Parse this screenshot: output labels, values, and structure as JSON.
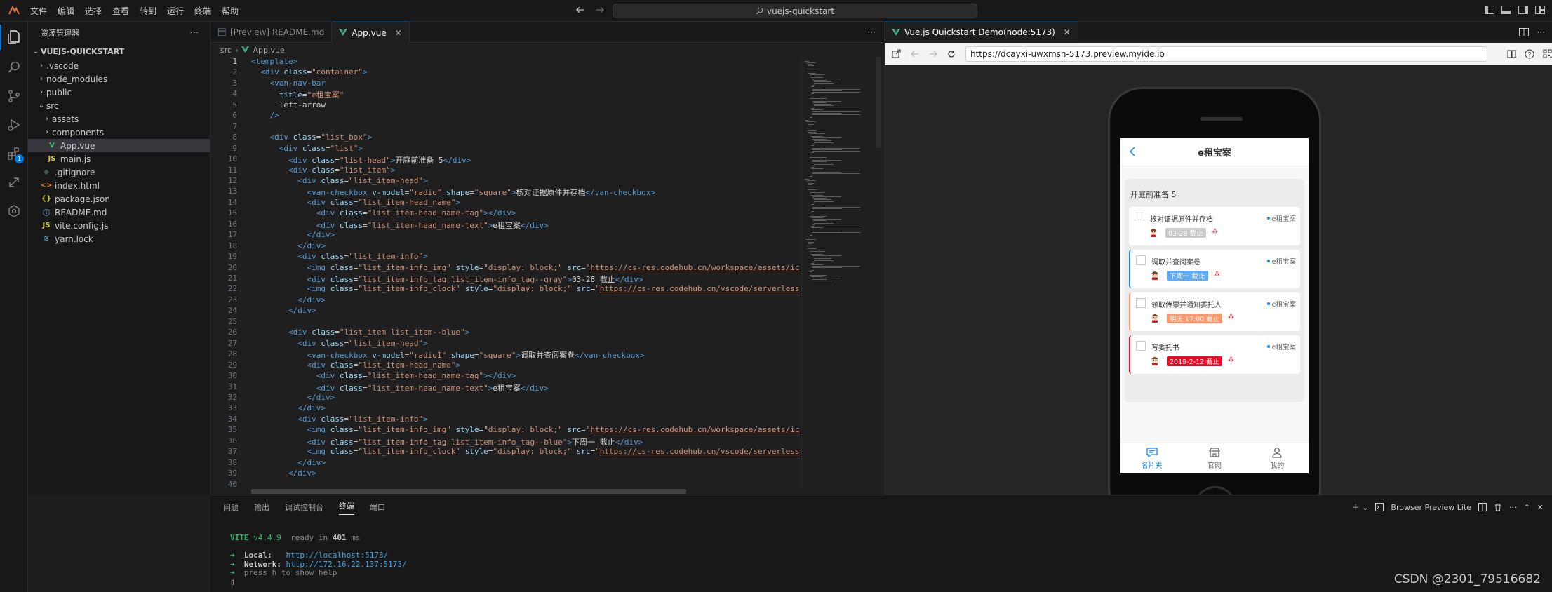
{
  "menubar": {
    "items": [
      "文件",
      "编辑",
      "选择",
      "查看",
      "转到",
      "运行",
      "终端",
      "帮助"
    ]
  },
  "command_center": {
    "text": "vuejs-quickstart"
  },
  "activity": {
    "extensions_badge": "1"
  },
  "explorer": {
    "title": "资源管理器",
    "root": "VUEJS-QUICKSTART",
    "items": [
      {
        "label": ".vscode",
        "kind": "folder",
        "depth": 1
      },
      {
        "label": "node_modules",
        "kind": "folder",
        "depth": 1
      },
      {
        "label": "public",
        "kind": "folder",
        "depth": 1
      },
      {
        "label": "src",
        "kind": "folder-open",
        "depth": 1
      },
      {
        "label": "assets",
        "kind": "folder",
        "depth": 2
      },
      {
        "label": "components",
        "kind": "folder",
        "depth": 2
      },
      {
        "label": "App.vue",
        "kind": "vue",
        "depth": 2,
        "selected": true
      },
      {
        "label": "main.js",
        "kind": "js",
        "depth": 2
      },
      {
        "label": ".gitignore",
        "kind": "git",
        "depth": 1
      },
      {
        "label": "index.html",
        "kind": "html",
        "depth": 1
      },
      {
        "label": "package.json",
        "kind": "json",
        "depth": 1
      },
      {
        "label": "README.md",
        "kind": "md",
        "depth": 1
      },
      {
        "label": "vite.config.js",
        "kind": "js",
        "depth": 1
      },
      {
        "label": "yarn.lock",
        "kind": "yarn",
        "depth": 1
      }
    ]
  },
  "editor": {
    "tabs": [
      {
        "label": "[Preview] README.md",
        "active": false
      },
      {
        "label": "App.vue",
        "active": true
      }
    ],
    "breadcrumb": [
      "src",
      "App.vue"
    ],
    "current_line": 1,
    "lines": [
      "<template>",
      "  <div class=\"container\">",
      "    <van-nav-bar",
      "      title=\"e租宝案\"",
      "      left-arrow",
      "    />",
      "",
      "    <div class=\"list_box\">",
      "      <div class=\"list\">",
      "        <div class=\"list-head\">开庭前准备 5</div>",
      "        <div class=\"list_item\">",
      "          <div class=\"list_item-head\">",
      "            <van-checkbox v-model=\"radio\" shape=\"square\">核对证据原件并存档</van-checkbox>",
      "            <div class=\"list_item-head_name\">",
      "              <div class=\"list_item-head_name-tag\"></div>",
      "              <div class=\"list_item-head_name-text\">e租宝案</div>",
      "            </div>",
      "          </div>",
      "          <div class=\"list_item-info\">",
      "            <img class=\"list_item-info_img\" style=\"display: block;\" src=\"https://cs-res.codehub.cn/workspace/assets/icons/embe",
      "            <div class=\"list_item-info_tag list_item-info_tag--gray\">03-28 截止</div>",
      "            <img class=\"list_item-info_clock\" style=\"display: block;\" src=\"https://cs-res.codehub.cn/vscode/serverless.svg\" la",
      "          </div>",
      "        </div>",
      "",
      "        <div class=\"list_item list_item--blue\">",
      "          <div class=\"list_item-head\">",
      "            <van-checkbox v-model=\"radio1\" shape=\"square\">调取并查阅案卷</van-checkbox>",
      "            <div class=\"list_item-head_name\">",
      "              <div class=\"list_item-head_name-tag\"></div>",
      "              <div class=\"list_item-head_name-text\">e租宝案</div>",
      "            </div>",
      "          </div>",
      "          <div class=\"list_item-info\">",
      "            <img class=\"list_item-info_img\" style=\"display: block;\" src=\"https://cs-res.codehub.cn/workspace/assets/icons/embe",
      "            <div class=\"list_item-info_tag list_item-info_tag--blue\">下周一 截止</div>",
      "            <img class=\"list_item-info_clock\" style=\"display: block;\" src=\"https://cs-res.codehub.cn/vscode/serverless.svg\" la",
      "          </div>",
      "        </div>",
      ""
    ]
  },
  "preview": {
    "tab_title": "Vue.js Quickstart Demo(node:5173)",
    "url": "https://dcayxi-uwxmsn-5173.preview.myide.io",
    "app": {
      "nav_title": "e租宝案",
      "list_head": "开庭前准备 5",
      "cards": [
        {
          "title": "核对证据原件并存档",
          "owner": "e租宝案",
          "tag": "03-28 截止",
          "tag_color": "#c8c9cc",
          "accent": "none"
        },
        {
          "title": "调取并查阅案卷",
          "owner": "e租宝案",
          "tag": "下周一 截止",
          "tag_color": "#5fa9f5",
          "accent": "blue"
        },
        {
          "title": "领取传票并通知委托人",
          "owner": "e租宝案",
          "tag": "明天 17:00 截止",
          "tag_color": "#ff976a",
          "accent": "orange"
        },
        {
          "title": "写委托书",
          "owner": "e租宝案",
          "tag": "2019-2-12 截止",
          "tag_color": "#ee0a24",
          "accent": "red"
        }
      ],
      "tabbar": [
        "名片夹",
        "官网",
        "我的"
      ]
    }
  },
  "panel": {
    "tabs": [
      "问题",
      "输出",
      "调试控制台",
      "终端",
      "端口"
    ],
    "active_tab": "终端",
    "right_label": "Browser Preview Lite",
    "terminal": {
      "vite": "VITE",
      "version": "v4.4.9",
      "ready_prefix": "ready in",
      "ready_ms": "401",
      "ready_unit": "ms",
      "local_label": "Local:",
      "local_url": "http://localhost:5173/",
      "network_label": "Network:",
      "network_url": "http://172.16.22.137:5173/",
      "help_line": "press h to show help",
      "prompt": "▯"
    }
  },
  "watermark": "CSDN @2301_79516682",
  "colors": {
    "accent": "#0078d4",
    "vue_green": "#42b883",
    "van_blue": "#1989fa"
  }
}
